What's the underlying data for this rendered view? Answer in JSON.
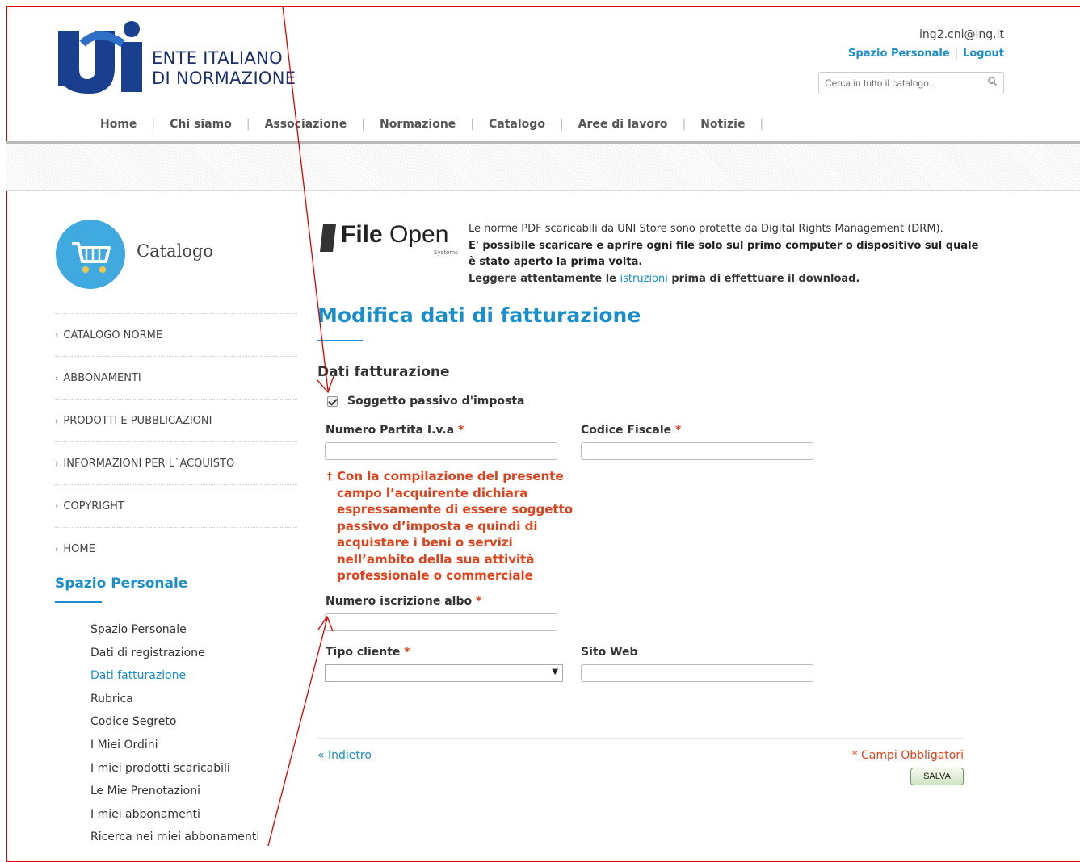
{
  "header": {
    "logo_line1": "ENTE ITALIANO",
    "logo_line2": "DI NORMAZIONE",
    "user_email": "ing2.cni@ing.it",
    "spazio_personale_link": "Spazio Personale",
    "logout_link": "Logout",
    "search_placeholder": "Cerca in tutto il catalogo...",
    "nav": [
      "Home",
      "Chi siamo",
      "Associazione",
      "Normazione",
      "Catalogo",
      "Aree di lavoro",
      "Notizie"
    ]
  },
  "sidebar": {
    "catalog_title": "Catalogo",
    "menu": [
      "CATALOGO NORME",
      "ABBONAMENTI",
      "PRODOTTI E PUBBLICAZIONI",
      "INFORMAZIONI PER L`ACQUISTO",
      "COPYRIGHT",
      "HOME"
    ],
    "spazio_title": "Spazio Personale",
    "spazio_items": [
      "Spazio Personale",
      "Dati di registrazione",
      "Dati fatturazione",
      "Rubrica",
      "Codice Segreto",
      "I Miei Ordini",
      "I miei prodotti scaricabili",
      "Le Mie Prenotazioni",
      "I miei abbonamenti",
      "Ricerca nei miei abbonamenti"
    ],
    "active_item": "Dati fatturazione"
  },
  "fileopen": {
    "logo_bold": "File",
    "logo_light": "Open",
    "logo_sub": "Systems",
    "line1": "Le norme PDF scaricabili da UNI Store sono protette da Digital Rights Management (DRM).",
    "line2": "E' possibile scaricare e aprire ogni file solo sul primo computer o dispositivo sul quale è stato aperto la prima volta.",
    "line3_pre": "Leggere attentamente le ",
    "line3_link": "istruzioni",
    "line3_post": " prima di effettuare il download."
  },
  "form": {
    "page_title": "Modifica dati di fatturazione",
    "section_title": "Dati fatturazione",
    "checkbox_label": "Soggetto passivo d'imposta",
    "checkbox_checked": true,
    "piva_label": "Numero Partita I.v.a",
    "cf_label": "Codice Fiscale",
    "required_mark": "*",
    "note_mark": "†",
    "note": "Con la compilazione del presente campo l’acquirente dichiara espressamente di essere soggetto passivo d’imposta e quindi di acquistare i beni o servizi nell’ambito della sua attività professionale o commerciale",
    "albo_label": "Numero iscrizione albo",
    "tipo_label": "Tipo cliente",
    "sito_label": "Sito Web",
    "back_link": "« Indietro",
    "mandatory_note": "* Campi Obbligatori",
    "save_button": "SALVA"
  },
  "colors": {
    "accent": "#1a8ecb",
    "required": "#e0401a",
    "annotation": "#dd0000"
  }
}
